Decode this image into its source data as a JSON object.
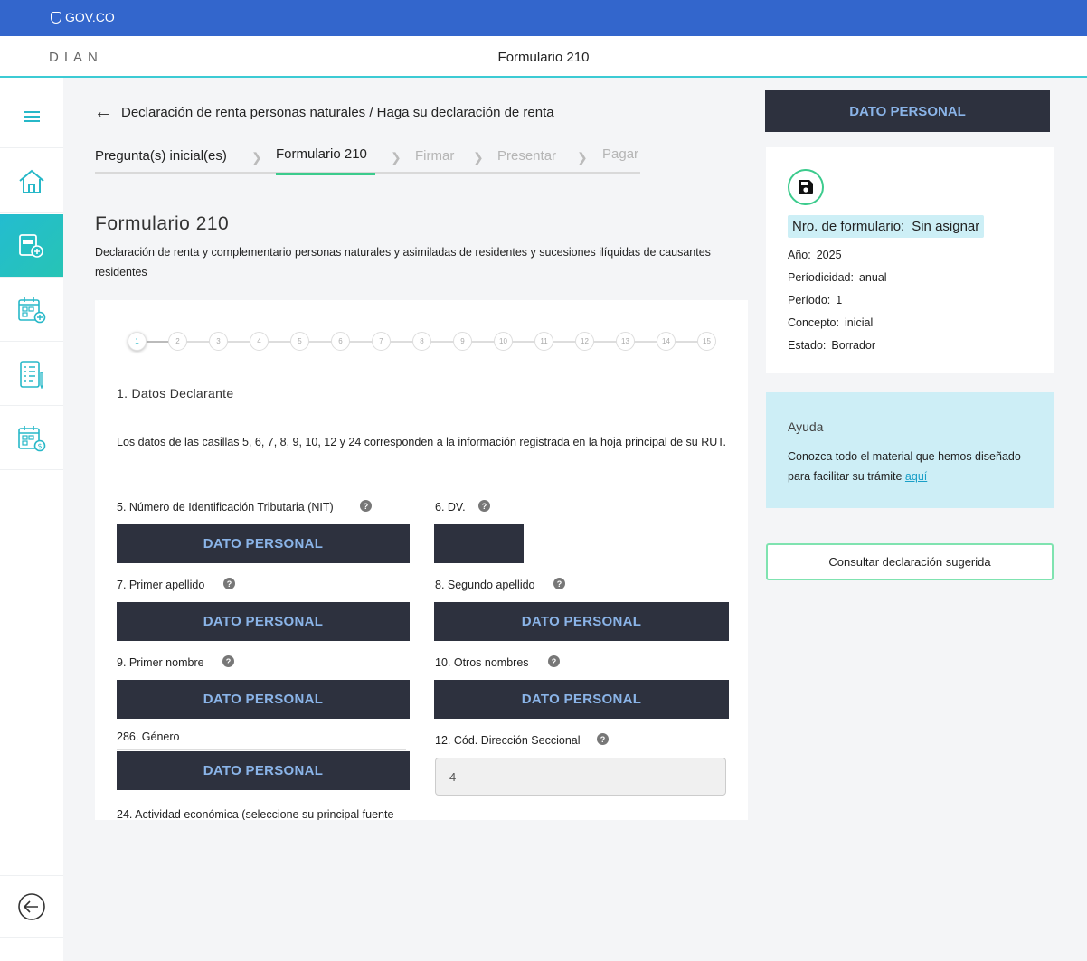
{
  "gov_bar": {
    "logo_text": "GOV.CO"
  },
  "header": {
    "logo": "DIAN",
    "title": "Formulario 210"
  },
  "sidebar": {
    "items": [
      {
        "icon": "menu-icon"
      },
      {
        "icon": "home-icon"
      },
      {
        "icon": "form-210-add-icon",
        "active": true
      },
      {
        "icon": "calendar-add-icon"
      },
      {
        "icon": "checklist-icon"
      },
      {
        "icon": "calendar-payment-icon"
      },
      {
        "icon": "back-circle-icon"
      }
    ]
  },
  "breadcrumb": {
    "text": "Declaración de renta personas naturales / Haga su declaración de renta"
  },
  "steps": [
    {
      "label": "Pregunta(s) inicial(es)",
      "state": "done"
    },
    {
      "label": "Formulario 210",
      "state": "current"
    },
    {
      "label": "Firmar",
      "state": "future"
    },
    {
      "label": "Presentar",
      "state": "future"
    },
    {
      "label": "Pagar",
      "state": "future"
    }
  ],
  "page": {
    "title": "Formulario 210",
    "description": "Declaración de renta y complementario personas naturales y asimiladas de residentes y sucesiones ilíquidas de causantes residentes"
  },
  "form": {
    "stepper": [
      "1",
      "2",
      "3",
      "4",
      "5",
      "6",
      "7",
      "8",
      "9",
      "10",
      "11",
      "12",
      "13",
      "14",
      "15"
    ],
    "current_step": "1",
    "section_title": "1. Datos Declarante",
    "section_desc": "Los datos de las casillas 5, 6, 7, 8, 9, 10, 12 y 24 corresponden a la información registrada en la hoja principal de su RUT.",
    "help_glyph": "?",
    "redacted_text": "DATO PERSONAL",
    "fields": {
      "nit_label": "5. Número de Identificación Tributaria (NIT)",
      "dv_label": "6. DV.",
      "primer_apellido_label": "7. Primer apellido",
      "segundo_apellido_label": "8. Segundo apellido",
      "primer_nombre_label": "9. Primer nombre",
      "otros_nombres_label": "10. Otros nombres",
      "genero_label": "286. Género",
      "cod_seccional_label": "12. Cód. Dirección Seccional",
      "cod_seccional_value": "4",
      "actividad_label": "24. Actividad económica (seleccione su principal fuente"
    }
  },
  "right_panel": {
    "banner": "DATO PERSONAL",
    "form_number_label": "Nro. de formulario:",
    "form_number_value": "Sin asignar",
    "rows": [
      {
        "label": "Año:",
        "value": "2025"
      },
      {
        "label": "Períodicidad:",
        "value": "anual"
      },
      {
        "label": "Período:",
        "value": "1"
      },
      {
        "label": "Concepto:",
        "value": "inicial"
      },
      {
        "label": "Estado:",
        "value": "Borrador"
      }
    ],
    "help_title": "Ayuda",
    "help_text": "Conozca todo el material que hemos diseñado para facilitar su trámite ",
    "help_link": "aquí",
    "suggest_button": "Consultar declaración sugerida"
  },
  "colors": {
    "gov_blue": "#3366cc",
    "accent_teal": "#3ccbd4",
    "accent_green": "#3ccb8d",
    "redaction": "#2d313e"
  }
}
